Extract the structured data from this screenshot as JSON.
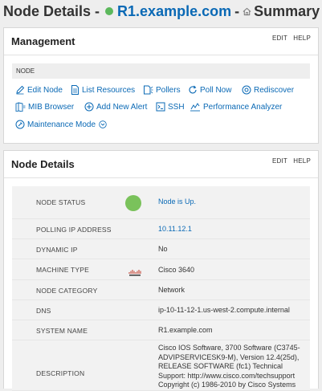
{
  "header": {
    "prefix": "Node Details -",
    "node_name": "R1.example.com",
    "separator": "-",
    "view": "Summary"
  },
  "management": {
    "title": "Management",
    "edit": "EDIT",
    "help": "HELP",
    "section_label": "NODE",
    "actions": [
      {
        "label": "Edit Node",
        "icon": "pencil-icon"
      },
      {
        "label": "List Resources",
        "icon": "document-list-icon"
      },
      {
        "label": "Pollers",
        "icon": "pollers-icon"
      },
      {
        "label": "Poll Now",
        "icon": "refresh-icon"
      },
      {
        "label": "Rediscover",
        "icon": "rediscover-icon"
      },
      {
        "label": "MIB Browser",
        "icon": "mib-browser-icon"
      },
      {
        "label": "Add New Alert",
        "icon": "plus-circle-icon"
      },
      {
        "label": "SSH",
        "icon": "terminal-icon"
      },
      {
        "label": "Performance Analyzer",
        "icon": "performance-analyzer-icon"
      },
      {
        "label": "Maintenance Mode",
        "icon": "maintenance-icon"
      }
    ]
  },
  "details": {
    "title": "Node Details",
    "edit": "EDIT",
    "help": "HELP",
    "rows": [
      {
        "key": "NODE STATUS",
        "value": "Node is Up."
      },
      {
        "key": "POLLING IP ADDRESS",
        "value": "10.11.12.1"
      },
      {
        "key": "DYNAMIC IP",
        "value": "No"
      },
      {
        "key": "MACHINE TYPE",
        "value": "Cisco 3640",
        "icon": "cisco-logo"
      },
      {
        "key": "NODE CATEGORY",
        "value": "Network"
      },
      {
        "key": "DNS",
        "value": "ip-10-11-12-1.us-west-2.compute.internal"
      },
      {
        "key": "SYSTEM NAME",
        "value": "R1.example.com"
      },
      {
        "key": "DESCRIPTION",
        "value": "Cisco IOS Software, 3700 Software (C3745-ADVIPSERVICESK9-M), Version 12.4(25d), RELEASE SOFTWARE (fc1) Technical Support: http://www.cisco.com/techsupport Copyright (c) 1986-2010 by Cisco Systems"
      }
    ]
  },
  "colors": {
    "status_up": "#7ac25b",
    "link": "#0a69b5"
  }
}
